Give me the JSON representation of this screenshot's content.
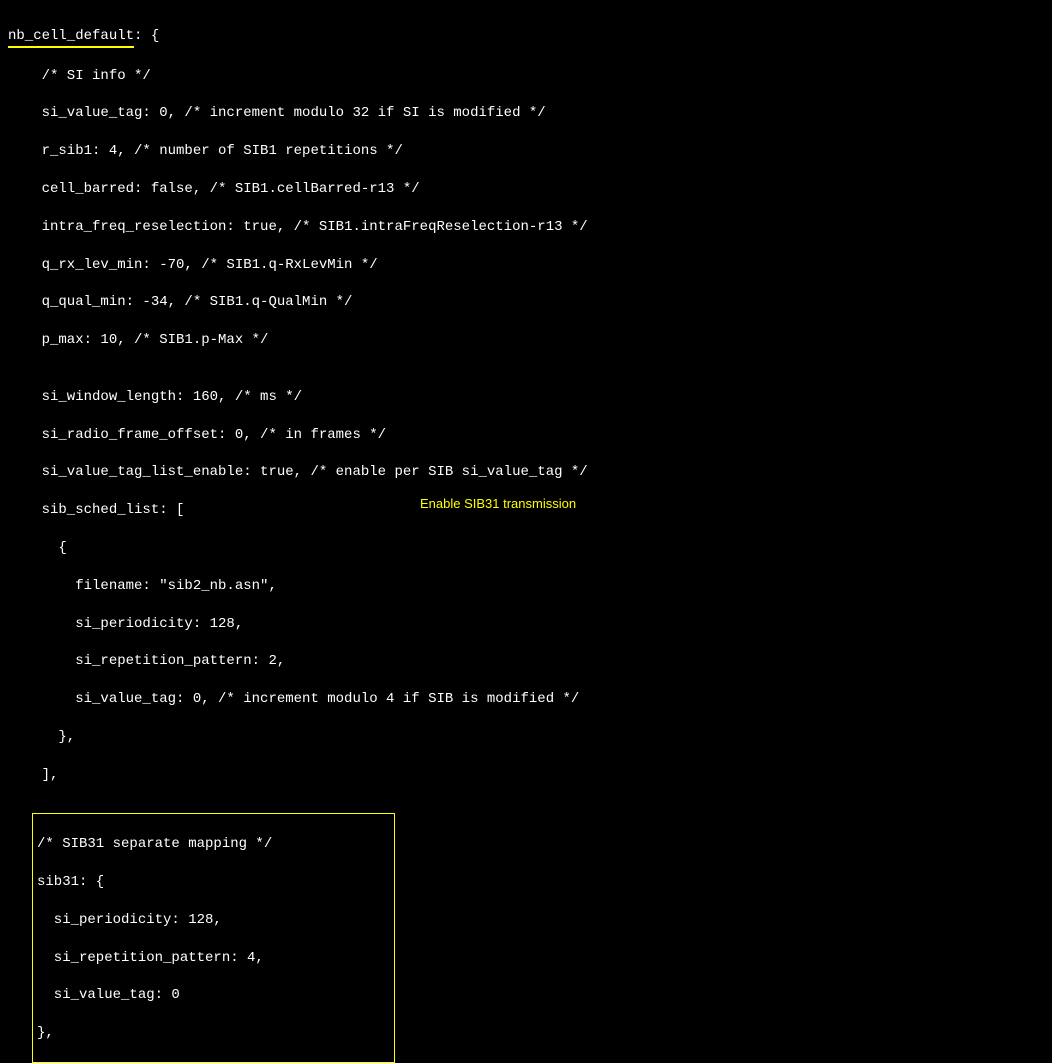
{
  "code": {
    "header": "nb_cell_default",
    "header_suffix": ": {",
    "lines": [
      "    /* SI info */",
      "    si_value_tag: 0, /* increment modulo 32 if SI is modified */",
      "    r_sib1: 4, /* number of SIB1 repetitions */",
      "    cell_barred: false, /* SIB1.cellBarred-r13 */",
      "    intra_freq_reselection: true, /* SIB1.intraFreqReselection-r13 */",
      "    q_rx_lev_min: -70, /* SIB1.q-RxLevMin */",
      "    q_qual_min: -34, /* SIB1.q-QualMin */",
      "    p_max: 10, /* SIB1.p-Max */",
      "",
      "    si_window_length: 160, /* ms */",
      "    si_radio_frame_offset: 0, /* in frames */",
      "    si_value_tag_list_enable: true, /* enable per SIB si_value_tag */",
      "    sib_sched_list: [",
      "      {",
      "        filename: \"sib2_nb.asn\",",
      "        si_periodicity: 128,",
      "        si_repetition_pattern: 2,",
      "        si_value_tag: 0, /* increment modulo 4 if SIB is modified */",
      "      },",
      "    ],"
    ],
    "sib31_lines": [
      "/* SIB31 separate mapping */              ",
      "sib31: {",
      "  si_periodicity: 128,",
      "  si_repetition_pattern: 4,",
      "  si_value_tag: 0",
      "},"
    ]
  },
  "annotation": {
    "text": "Enable SIB31 transmission"
  }
}
